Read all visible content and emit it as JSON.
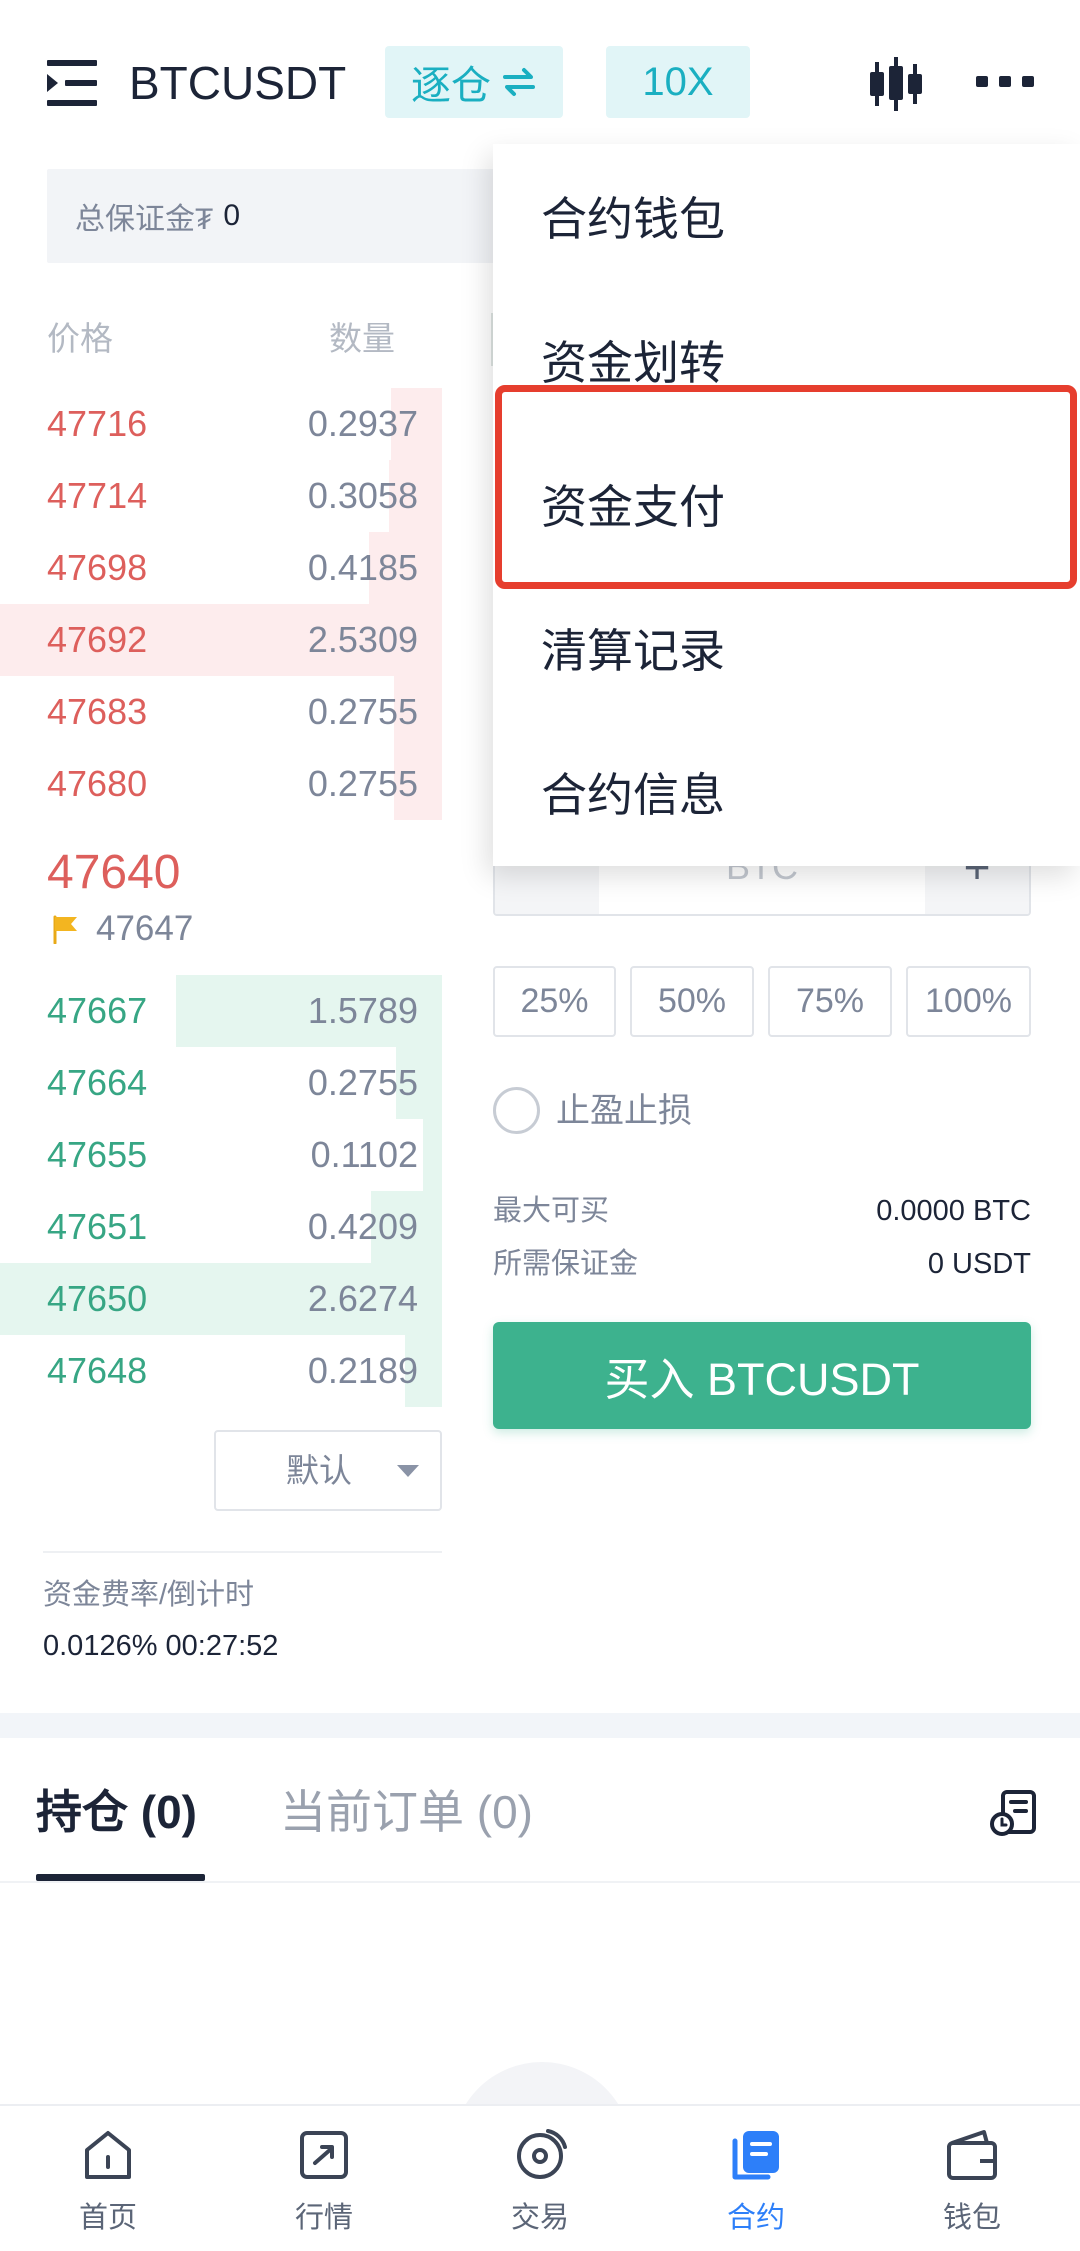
{
  "header": {
    "symbol": "BTCUSDT",
    "margin_mode": "逐仓",
    "leverage": "10X"
  },
  "margin_summary": {
    "label": "总保证金₮",
    "value": "0"
  },
  "order_book": {
    "price_header": "价格",
    "amount_header": "数量",
    "asks": [
      {
        "price": "47716",
        "amount": "0.2937"
      },
      {
        "price": "47714",
        "amount": "0.3058"
      },
      {
        "price": "47698",
        "amount": "0.4185"
      },
      {
        "price": "47692",
        "amount": "2.5309"
      },
      {
        "price": "47683",
        "amount": "0.2755"
      },
      {
        "price": "47680",
        "amount": "0.2755"
      }
    ],
    "last_price": "47640",
    "mark_price": "47647",
    "bids": [
      {
        "price": "47667",
        "amount": "1.5789"
      },
      {
        "price": "47664",
        "amount": "0.2755"
      },
      {
        "price": "47655",
        "amount": "0.1102"
      },
      {
        "price": "47651",
        "amount": "0.4209"
      },
      {
        "price": "47650",
        "amount": "2.6274"
      },
      {
        "price": "47648",
        "amount": "0.2189"
      }
    ],
    "depth_mode": "默认"
  },
  "funding": {
    "label": "资金费率/倒计时",
    "value": "0.0126% 00:27:52"
  },
  "trade_panel": {
    "quantity_placeholder": "BTC",
    "quantity_increment": "+",
    "percent_options": [
      "25%",
      "50%",
      "75%",
      "100%"
    ],
    "tp_sl_label": "止盈止损",
    "tp_sl_checked": false,
    "max_buy_label": "最大可买",
    "max_buy_value": "0.0000 BTC",
    "required_margin_label": "所需保证金",
    "required_margin_value": "0 USDT",
    "buy_button": "买入 BTCUSDT"
  },
  "dropdown_menu": {
    "items": [
      "合约钱包",
      "资金划转",
      "资金支付",
      "清算记录",
      "合约信息"
    ],
    "annotated_item_index": 2
  },
  "position_tabs": [
    {
      "label": "持仓 (0)",
      "active": true
    },
    {
      "label": "当前订单 (0)",
      "active": false
    }
  ],
  "bottom_nav": [
    {
      "label": "首页",
      "icon": "home-icon",
      "active": false
    },
    {
      "label": "行情",
      "icon": "market-icon",
      "active": false
    },
    {
      "label": "交易",
      "icon": "trade-icon",
      "active": false
    },
    {
      "label": "合约",
      "icon": "contract-icon",
      "active": true
    },
    {
      "label": "钱包",
      "icon": "wallet-icon",
      "active": false
    }
  ],
  "icons": {
    "header_menu": "menu-fold-icon",
    "margin_mode_swap": "swap-icon",
    "chart": "candlestick-icon",
    "more": "more-icon",
    "mark_price": "flag-icon",
    "depth_select": "caret-down-icon",
    "order_history": "order-history-icon"
  },
  "colors": {
    "ask": "#dd5f5c",
    "bid": "#37a684",
    "ask_depth": "#fdeced",
    "bid_depth": "#e5f6ef",
    "buy_button": "#3db28e",
    "badge_bg": "#e1f5f7",
    "badge_text": "#1aafc1",
    "nav_active": "#2d7ff9",
    "highlight": "#e63e2e"
  }
}
